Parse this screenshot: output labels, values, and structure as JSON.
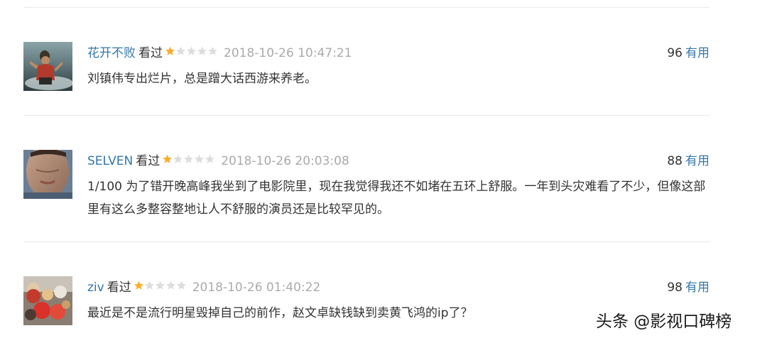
{
  "comments": [
    {
      "username": "花开不败",
      "status": "看过",
      "rating": 1,
      "rating_max": 5,
      "timestamp": "2018-10-26 10:47:21",
      "votes": "96",
      "useful_label": "有用",
      "text": "刘镇伟专出烂片，总是蹭大话西游来养老。",
      "avatar_icon": "movie-poster-avatar"
    },
    {
      "username": "SELVEN",
      "status": "看过",
      "rating": 1,
      "rating_max": 5,
      "timestamp": "2018-10-26 20:03:08",
      "votes": "88",
      "useful_label": "有用",
      "text": "1/100 为了错开晚高峰我坐到了电影院里，现在我觉得我还不如堵在五环上舒服。一年到头灾难看了不少，但像这部里有这么多整容整地让人不舒服的演员还是比较罕见的。",
      "avatar_icon": "face-photo-avatar"
    },
    {
      "username": "ziv",
      "status": "看过",
      "rating": 1,
      "rating_max": 5,
      "timestamp": "2018-10-26 01:40:22",
      "votes": "98",
      "useful_label": "有用",
      "text": "最近是不是流行明星毁掉自己的前作，赵文卓缺钱缺到卖黄飞鸿的ip了？",
      "avatar_icon": "toys-photo-avatar"
    }
  ],
  "watermark": "头条 @影视口碑榜",
  "colors": {
    "link": "#3377aa",
    "star_on": "#ffac2d",
    "star_off": "#dddddd",
    "time": "#aaaaaa",
    "divider": "#e8e8e8"
  }
}
